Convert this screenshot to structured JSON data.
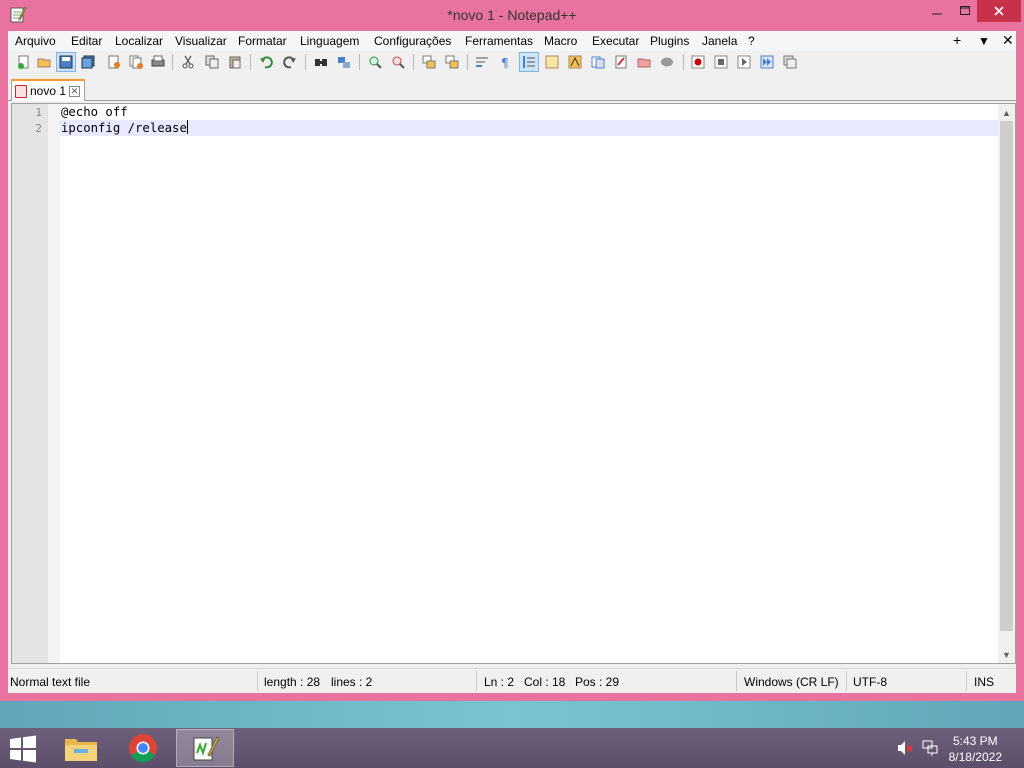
{
  "window": {
    "title": "*novo 1 - Notepad++"
  },
  "menu": {
    "items": [
      "Arquivo",
      "Editar",
      "Localizar",
      "Visualizar",
      "Formatar",
      "Linguagem",
      "Configurações",
      "Ferramentas",
      "Macro",
      "Executar",
      "Plugins",
      "Janela",
      "?"
    ],
    "right_buttons": [
      "+",
      "▼",
      "✕"
    ]
  },
  "toolbar": {
    "icons": [
      "new-file-icon",
      "open-file-icon",
      "save-icon",
      "save-all-icon",
      "close-icon",
      "close-all-icon",
      "print-icon",
      "cut-icon",
      "copy-icon",
      "paste-icon",
      "undo-icon",
      "redo-icon",
      "find-icon",
      "replace-icon",
      "zoom-in-icon",
      "zoom-out-icon",
      "sync-vertical-icon",
      "sync-horizontal-icon",
      "word-wrap-icon",
      "show-all-chars-icon",
      "indent-guide-icon",
      "udl-icon",
      "doc-map-icon",
      "function-list-icon",
      "folder-as-workspace-icon",
      "monitoring-icon",
      "record-macro-icon",
      "stop-record-icon",
      "play-macro-icon",
      "run-macro-multiple-icon",
      "save-macro-icon"
    ]
  },
  "tabs": [
    {
      "label": "novo 1",
      "modified": true
    }
  ],
  "editor": {
    "lines": [
      {
        "number": "1",
        "text": "@echo off"
      },
      {
        "number": "2",
        "text": "ipconfig /release"
      }
    ],
    "current_line": 2
  },
  "status": {
    "file_type": "Normal text file",
    "length": "length : 28",
    "lines": "lines : 2",
    "ln": "Ln : 2",
    "col": "Col : 18",
    "pos": "Pos : 29",
    "eol": "Windows (CR LF)",
    "encoding": "UTF-8",
    "mode": "INS"
  },
  "taskbar": {
    "apps": [
      "file-explorer-icon",
      "chrome-icon",
      "notepadpp-icon"
    ],
    "active_app": "notepadpp-icon",
    "time": "5:43 PM",
    "date": "8/18/2022"
  },
  "colors": {
    "window_frame": "#e8739e",
    "close_button": "#c7314a",
    "current_line": "#e8e8ff",
    "tab_accent": "#fa9a31"
  }
}
